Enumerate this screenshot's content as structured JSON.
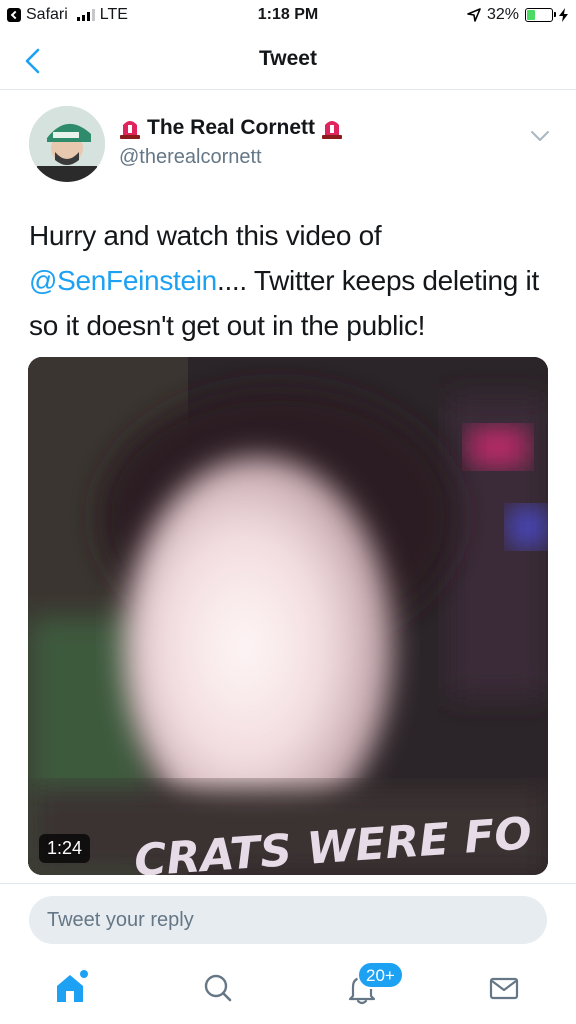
{
  "status_bar": {
    "app": "Safari",
    "network": "LTE",
    "time": "1:18 PM",
    "battery": "32%",
    "battery_level": 0.32
  },
  "nav": {
    "title": "Tweet"
  },
  "tweet": {
    "display_name": "The Real Cornett",
    "handle": "@therealcornett",
    "text_before": "Hurry and watch this video of ",
    "mention": "@SenFeinstein",
    "text_after": ".... Twitter keeps deleting it so it doesn't get out in the public!",
    "media": {
      "duration": "1:24",
      "caption": "CRATS WERE FO"
    }
  },
  "reply": {
    "placeholder": "Tweet your reply"
  },
  "tab_bar": {
    "notifications_badge": "20+",
    "tabs": [
      "home-icon",
      "search-icon",
      "bell-icon",
      "mail-icon"
    ]
  },
  "colors": {
    "accent": "#1da1f2",
    "secondary_text": "#657786",
    "siren_red": "#e0245e"
  }
}
